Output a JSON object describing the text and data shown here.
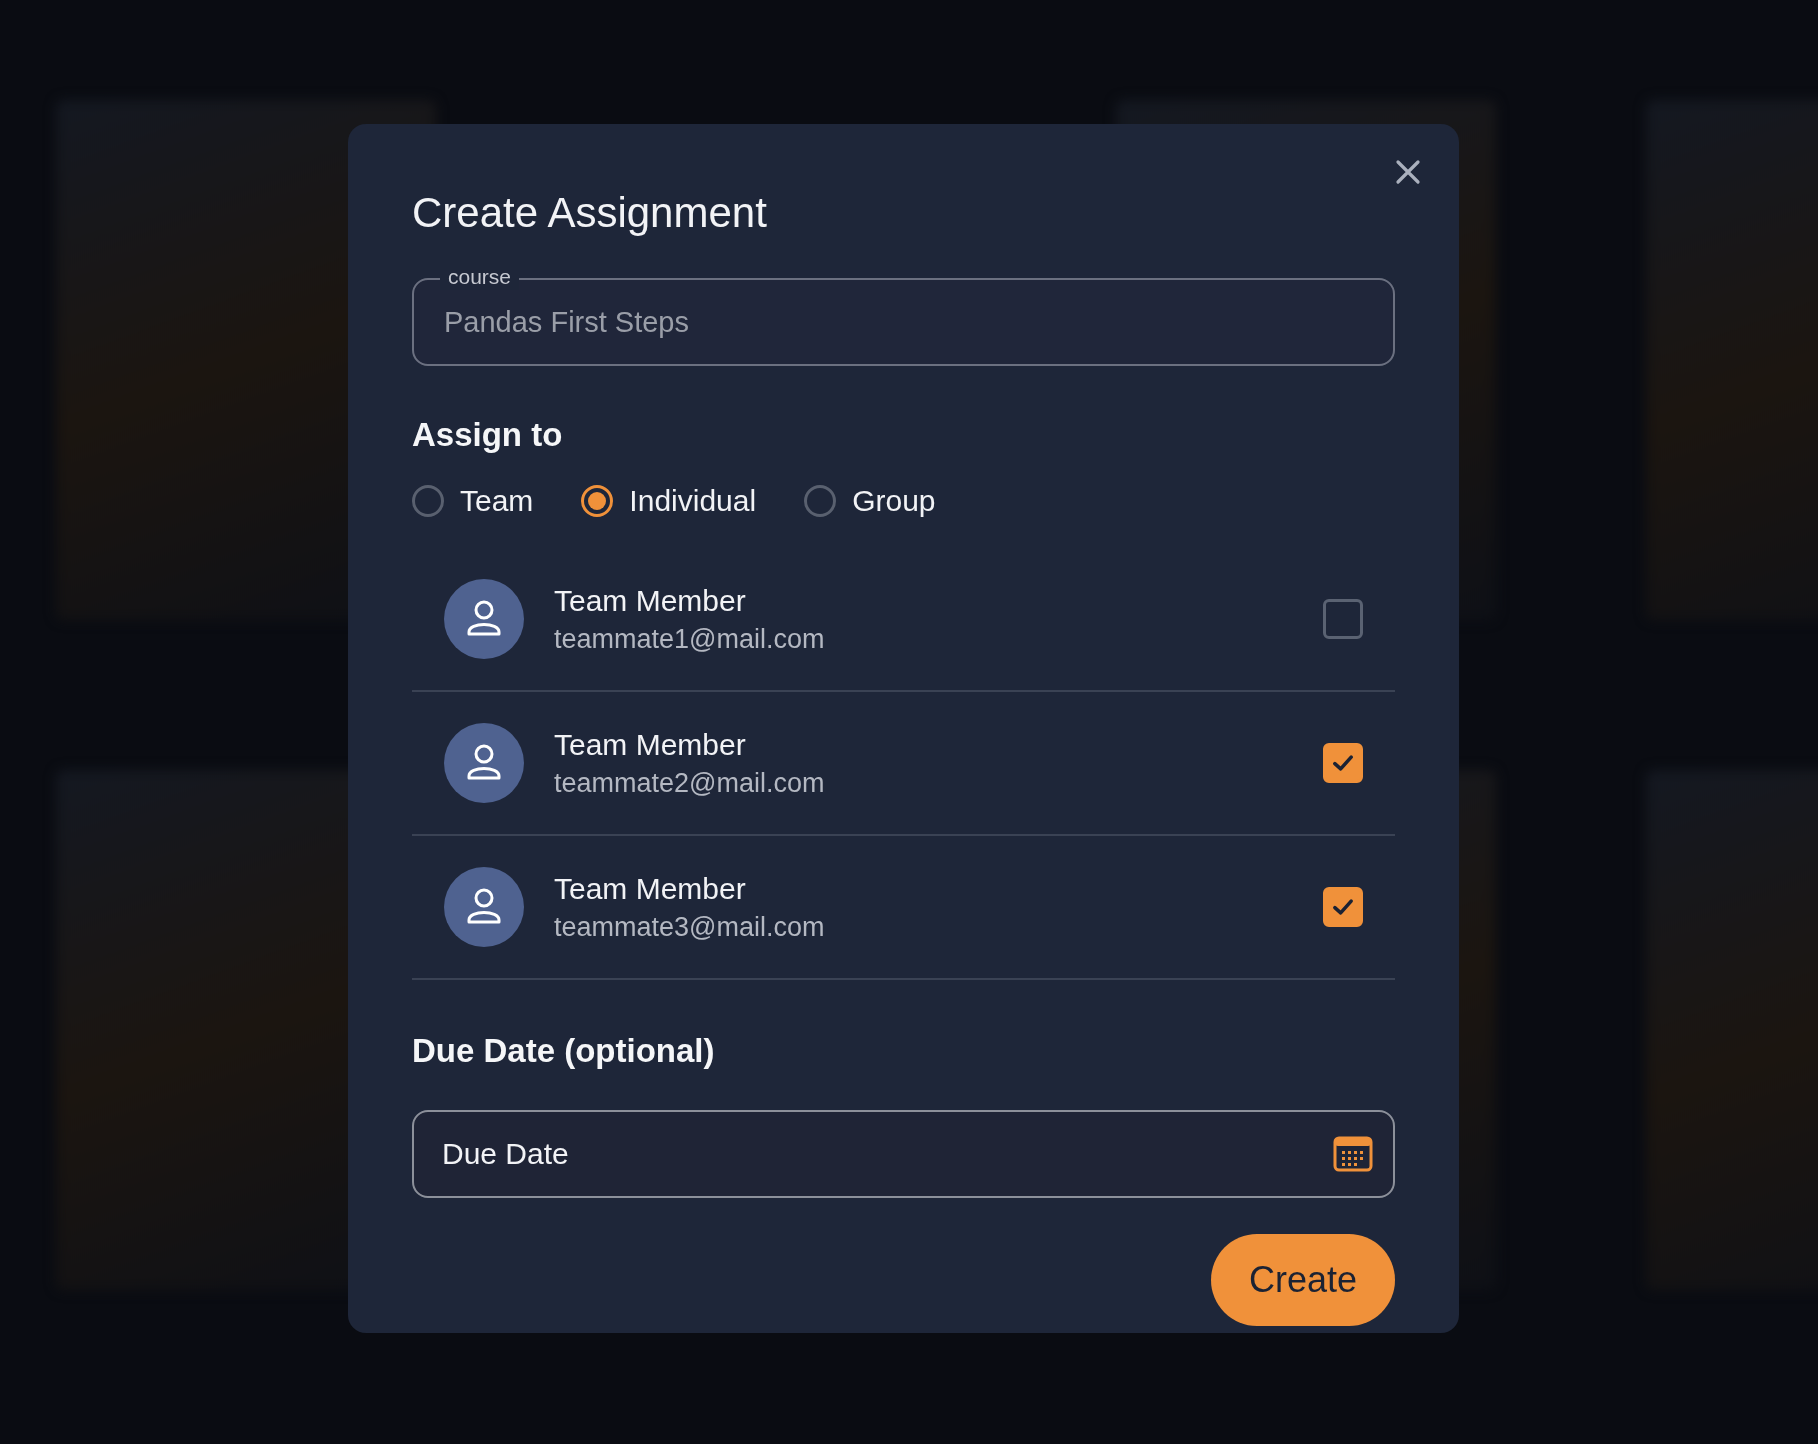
{
  "dialog": {
    "title": "Create Assignment"
  },
  "course": {
    "label": "course",
    "value": "Pandas First Steps"
  },
  "assign": {
    "heading": "Assign to",
    "options": [
      {
        "label": "Team",
        "selected": false
      },
      {
        "label": "Individual",
        "selected": true
      },
      {
        "label": "Group",
        "selected": false
      }
    ]
  },
  "members": [
    {
      "name": "Team Member",
      "email": "teammate1@mail.com",
      "checked": false
    },
    {
      "name": "Team Member",
      "email": "teammate2@mail.com",
      "checked": true
    },
    {
      "name": "Team Member",
      "email": "teammate3@mail.com",
      "checked": true
    }
  ],
  "due_date": {
    "heading": "Due Date (optional)",
    "placeholder": "Due Date"
  },
  "buttons": [
    "Create"
  ]
}
